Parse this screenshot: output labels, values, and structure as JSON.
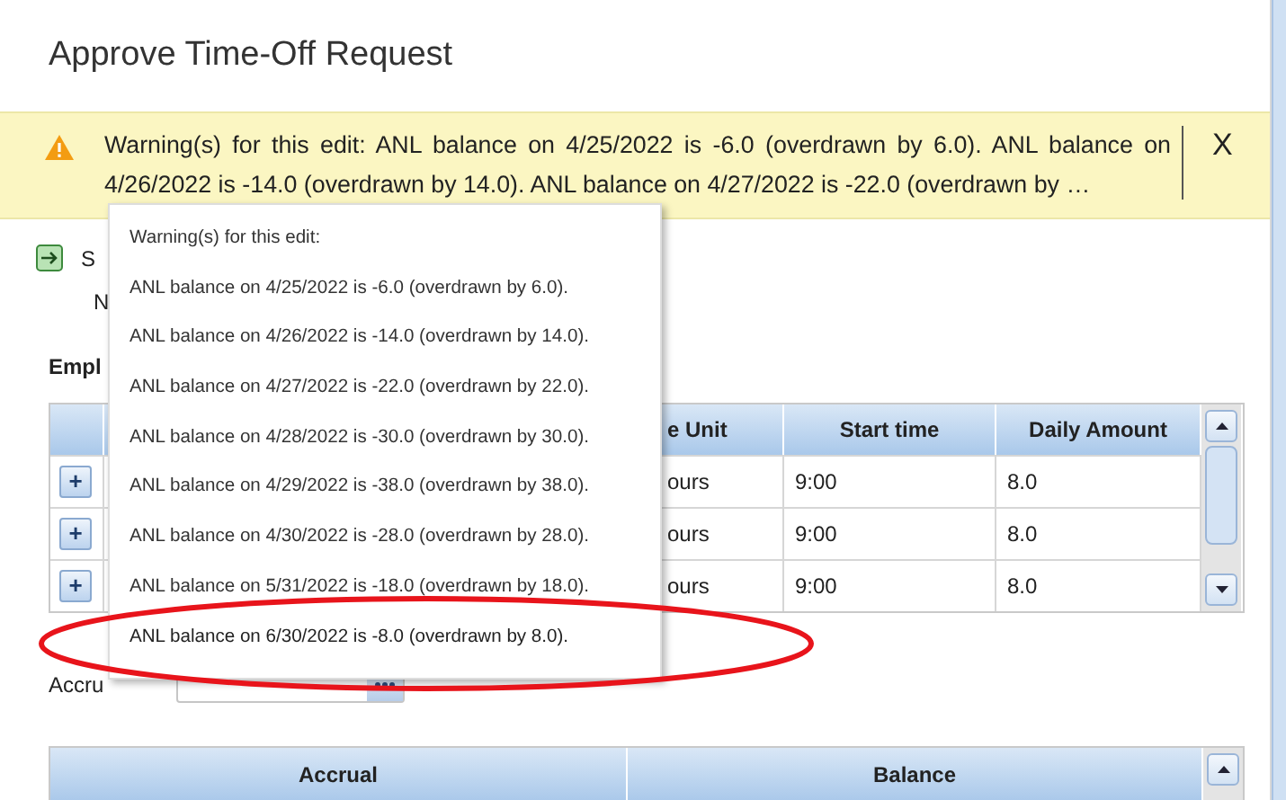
{
  "window": {
    "title": "Approve Time-Off Request"
  },
  "warning_banner": {
    "text": "Warning(s) for this edit: ANL balance on 4/25/2022 is -6.0 (overdrawn by 6.0). ANL balance on 4/26/2022 is -14.0 (overdrawn by 14.0). ANL balance on 4/27/2022 is -22.0 (overdrawn by …",
    "close": "X"
  },
  "form": {
    "status_label": "S",
    "line_2": "N",
    "section_label": "Empl"
  },
  "requests_table": {
    "columns": [
      "e Unit",
      "Start time",
      "Daily Amount"
    ],
    "rows": [
      {
        "expand": "+",
        "unit": "ours",
        "start": "9:00",
        "amount": "8.0"
      },
      {
        "expand": "+",
        "unit": "ours",
        "start": "9:00",
        "amount": "8.0"
      },
      {
        "expand": "+",
        "unit": "ours",
        "start": "9:00",
        "amount": "8.0"
      }
    ]
  },
  "accrual_field": {
    "label": "Accru"
  },
  "balance_table": {
    "columns": [
      "Accrual",
      "Balance"
    ]
  },
  "warning_popup": {
    "heading": "Warning(s) for this edit:",
    "items": [
      {
        "text": "ANL balance on 4/25/2022 is -6.0 (overdrawn by 6.0).",
        "circled": false
      },
      {
        "text": "ANL balance on 4/26/2022 is -14.0 (overdrawn by 14.0).",
        "circled": false
      },
      {
        "text": "ANL balance on 4/27/2022 is -22.0 (overdrawn by 22.0).",
        "circled": false
      },
      {
        "text": "ANL balance on 4/28/2022 is -30.0 (overdrawn by 30.0).",
        "circled": false
      },
      {
        "text": "ANL balance on 4/29/2022 is -38.0 (overdrawn by 38.0).",
        "circled": false
      },
      {
        "text": "ANL balance on 4/30/2022 is -28.0 (overdrawn by 28.0).",
        "circled": false
      },
      {
        "text": "ANL balance on 5/31/2022 is -18.0 (overdrawn by 18.0).",
        "circled": false
      },
      {
        "text": "ANL balance on 6/30/2022 is -8.0 (overdrawn by 8.0).",
        "circled": true
      }
    ]
  }
}
